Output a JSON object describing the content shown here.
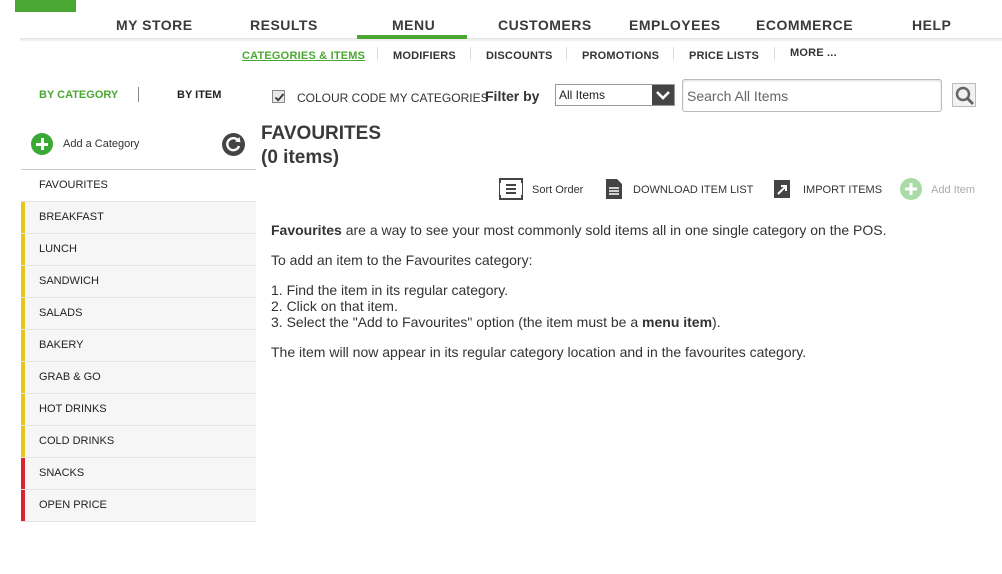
{
  "nav": {
    "items": [
      "MY STORE",
      "RESULTS",
      "MENU",
      "CUSTOMERS",
      "EMPLOYEES",
      "ECOMMERCE",
      "HELP"
    ],
    "active": "MENU"
  },
  "subnav": {
    "items": [
      "CATEGORIES & ITEMS",
      "MODIFIERS",
      "DISCOUNTS",
      "PROMOTIONS",
      "PRICE LISTS",
      "MORE ..."
    ],
    "active": "CATEGORIES & ITEMS"
  },
  "view": {
    "by_category": "BY CATEGORY",
    "by_item": "BY ITEM"
  },
  "add_category": "Add a Category",
  "categories": [
    {
      "label": "FAVOURITES",
      "color": ""
    },
    {
      "label": "BREAKFAST",
      "color": "#e8c61c"
    },
    {
      "label": "LUNCH",
      "color": "#e8c61c"
    },
    {
      "label": "SANDWICH",
      "color": "#e8c61c"
    },
    {
      "label": "SALADS",
      "color": "#e8c61c"
    },
    {
      "label": "BAKERY",
      "color": "#e8c61c"
    },
    {
      "label": "GRAB & GO",
      "color": "#e8c61c"
    },
    {
      "label": "HOT DRINKS",
      "color": "#e8c61c"
    },
    {
      "label": "COLD DRINKS",
      "color": "#e8c61c"
    },
    {
      "label": "SNACKS",
      "color": "#d9232e"
    },
    {
      "label": "OPEN PRICE",
      "color": "#d9232e"
    }
  ],
  "filters": {
    "colour_code_label": "COLOUR CODE MY CATEGORIES",
    "colour_code_checked": true,
    "filter_by_label": "Filter by",
    "filter_value": "All Items",
    "search_placeholder": "Search All Items"
  },
  "main": {
    "title_line1": "FAVOURITES",
    "title_line2": "(0 items)",
    "actions": {
      "sort": "Sort Order",
      "download": "DOWNLOAD ITEM LIST",
      "import": "IMPORT ITEMS",
      "add": "Add Item"
    },
    "intro_bold": "Favourites",
    "intro_rest": " are a way to see your most commonly sold items all in one single category on the POS.",
    "how_to": "To add an item to the Favourites category:",
    "step1": "1. Find the item in its regular category.",
    "step2": "2. Click on that item.",
    "step3_pre": "3. Select the \"Add to Favourites\" option (the item must be a ",
    "step3_bold": "menu item",
    "step3_post": ").",
    "outro": "The item will now appear in its regular category location and in the favourites category."
  },
  "colors": {
    "accent": "#4aa832",
    "yellow": "#e8c61c",
    "red": "#d9232e"
  }
}
